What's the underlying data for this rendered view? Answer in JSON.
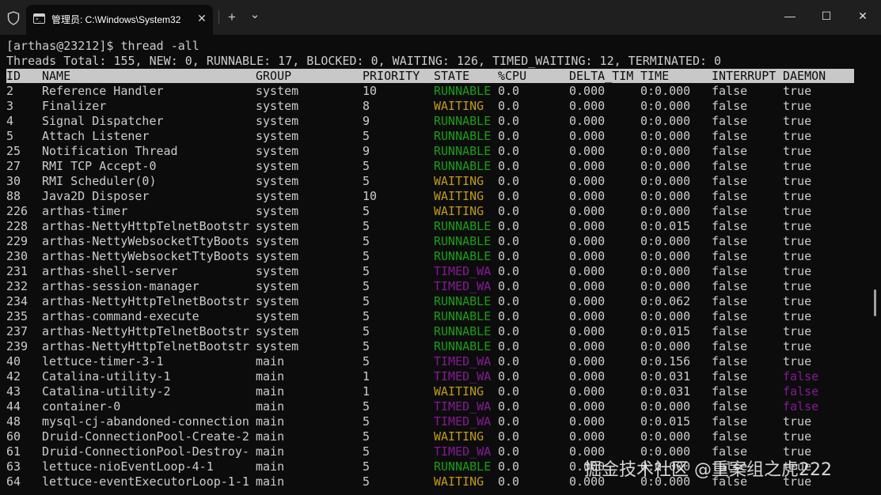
{
  "window": {
    "tab_title": "管理员: C:\\Windows\\System32",
    "tab_icon_text": ">_",
    "close_tab": "✕",
    "new_tab": "+",
    "dropdown": "⌄",
    "minimize": "—",
    "maximize": "☐",
    "close": "✕"
  },
  "terminal": {
    "prompt": "[arthas@23212]$ thread -all",
    "summary": "Threads Total: 155, NEW: 0, RUNNABLE: 17, BLOCKED: 0, WAITING: 126, TIMED_WAITING: 12, TERMINATED: 0",
    "columns": [
      "ID",
      "NAME",
      "GROUP",
      "PRIORITY",
      "STATE",
      "%CPU",
      "DELTA_TIM",
      "TIME",
      "INTERRUPT",
      "DAEMON"
    ],
    "rows": [
      [
        "2",
        "Reference Handler",
        "system",
        "10",
        "RUNNABLE",
        "0.0",
        "0.000",
        "0:0.000",
        "false",
        "true"
      ],
      [
        "3",
        "Finalizer",
        "system",
        "8",
        "WAITING",
        "0.0",
        "0.000",
        "0:0.000",
        "false",
        "true"
      ],
      [
        "4",
        "Signal Dispatcher",
        "system",
        "9",
        "RUNNABLE",
        "0.0",
        "0.000",
        "0:0.000",
        "false",
        "true"
      ],
      [
        "5",
        "Attach Listener",
        "system",
        "5",
        "RUNNABLE",
        "0.0",
        "0.000",
        "0:0.000",
        "false",
        "true"
      ],
      [
        "25",
        "Notification Thread",
        "system",
        "9",
        "RUNNABLE",
        "0.0",
        "0.000",
        "0:0.000",
        "false",
        "true"
      ],
      [
        "27",
        "RMI TCP Accept-0",
        "system",
        "5",
        "RUNNABLE",
        "0.0",
        "0.000",
        "0:0.000",
        "false",
        "true"
      ],
      [
        "30",
        "RMI Scheduler(0)",
        "system",
        "5",
        "WAITING",
        "0.0",
        "0.000",
        "0:0.000",
        "false",
        "true"
      ],
      [
        "88",
        "Java2D Disposer",
        "system",
        "10",
        "WAITING",
        "0.0",
        "0.000",
        "0:0.000",
        "false",
        "true"
      ],
      [
        "226",
        "arthas-timer",
        "system",
        "5",
        "WAITING",
        "0.0",
        "0.000",
        "0:0.000",
        "false",
        "true"
      ],
      [
        "228",
        "arthas-NettyHttpTelnetBootstr",
        "system",
        "5",
        "RUNNABLE",
        "0.0",
        "0.000",
        "0:0.015",
        "false",
        "true"
      ],
      [
        "229",
        "arthas-NettyWebsocketTtyBoots",
        "system",
        "5",
        "RUNNABLE",
        "0.0",
        "0.000",
        "0:0.000",
        "false",
        "true"
      ],
      [
        "230",
        "arthas-NettyWebsocketTtyBoots",
        "system",
        "5",
        "RUNNABLE",
        "0.0",
        "0.000",
        "0:0.000",
        "false",
        "true"
      ],
      [
        "231",
        "arthas-shell-server",
        "system",
        "5",
        "TIMED_WA",
        "0.0",
        "0.000",
        "0:0.000",
        "false",
        "true"
      ],
      [
        "232",
        "arthas-session-manager",
        "system",
        "5",
        "TIMED_WA",
        "0.0",
        "0.000",
        "0:0.000",
        "false",
        "true"
      ],
      [
        "234",
        "arthas-NettyHttpTelnetBootstr",
        "system",
        "5",
        "RUNNABLE",
        "0.0",
        "0.000",
        "0:0.062",
        "false",
        "true"
      ],
      [
        "235",
        "arthas-command-execute",
        "system",
        "5",
        "RUNNABLE",
        "0.0",
        "0.000",
        "0:0.000",
        "false",
        "true"
      ],
      [
        "237",
        "arthas-NettyHttpTelnetBootstr",
        "system",
        "5",
        "RUNNABLE",
        "0.0",
        "0.000",
        "0:0.015",
        "false",
        "true"
      ],
      [
        "239",
        "arthas-NettyHttpTelnetBootstr",
        "system",
        "5",
        "RUNNABLE",
        "0.0",
        "0.000",
        "0:0.000",
        "false",
        "true"
      ],
      [
        "40",
        "lettuce-timer-3-1",
        "main",
        "5",
        "TIMED_WA",
        "0.0",
        "0.000",
        "0:0.156",
        "false",
        "true"
      ],
      [
        "42",
        "Catalina-utility-1",
        "main",
        "1",
        "TIMED_WA",
        "0.0",
        "0.000",
        "0:0.031",
        "false",
        "false"
      ],
      [
        "43",
        "Catalina-utility-2",
        "main",
        "1",
        "WAITING",
        "0.0",
        "0.000",
        "0:0.031",
        "false",
        "false"
      ],
      [
        "44",
        "container-0",
        "main",
        "5",
        "TIMED_WA",
        "0.0",
        "0.000",
        "0:0.000",
        "false",
        "false"
      ],
      [
        "48",
        "mysql-cj-abandoned-connection",
        "main",
        "5",
        "TIMED_WA",
        "0.0",
        "0.000",
        "0:0.015",
        "false",
        "true"
      ],
      [
        "60",
        "Druid-ConnectionPool-Create-2",
        "main",
        "5",
        "WAITING",
        "0.0",
        "0.000",
        "0:0.000",
        "false",
        "true"
      ],
      [
        "61",
        "Druid-ConnectionPool-Destroy-",
        "main",
        "5",
        "TIMED_WA",
        "0.0",
        "0.000",
        "0:0.000",
        "false",
        "true"
      ],
      [
        "63",
        "lettuce-nioEventLoop-4-1",
        "main",
        "5",
        "RUNNABLE",
        "0.0",
        "0.000",
        "0:0.000",
        "false",
        "true"
      ],
      [
        "64",
        "lettuce-eventExecutorLoop-1-1",
        "main",
        "5",
        "WAITING",
        "0.0",
        "0.000",
        "0:0.000",
        "false",
        "true"
      ]
    ]
  },
  "watermark": "掘金技术社区 @重案组之虎222",
  "colors": {
    "runnable": "#13a10e",
    "waiting": "#c19c00",
    "timed_waiting": "#881798",
    "daemon_false": "#881798",
    "foreground": "#cccccc",
    "background": "#0c0c0c",
    "header_bar": "#c8c8c8"
  }
}
